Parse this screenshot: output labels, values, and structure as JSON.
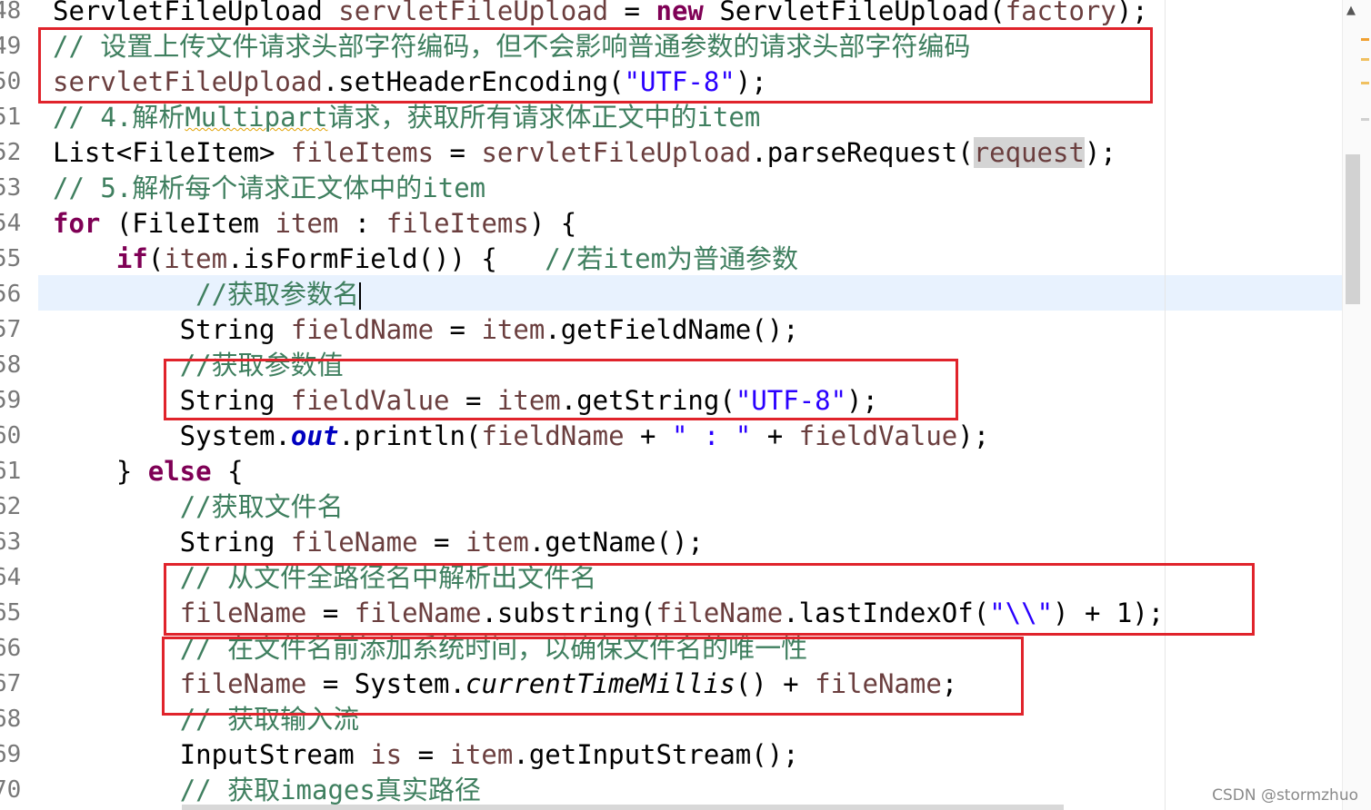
{
  "editor": {
    "lines": [
      {
        "n": "48",
        "tokens": [
          {
            "t": "ServletFileUpload "
          },
          {
            "t": "servletFileUpload",
            "c": "var"
          },
          {
            "t": " = "
          },
          {
            "t": "new",
            "c": "kw"
          },
          {
            "t": " ServletFileUpload("
          },
          {
            "t": "factory",
            "c": "var"
          },
          {
            "t": ");"
          }
        ]
      },
      {
        "n": "49",
        "tokens": [
          {
            "t": "// 设置上传文件请求头部字符编码，但不会影响普通参数的请求头部字符编码",
            "c": "cm"
          }
        ]
      },
      {
        "n": "50",
        "tokens": [
          {
            "t": "servletFileUpload",
            "c": "var"
          },
          {
            "t": ".setHeaderEncoding("
          },
          {
            "t": "\"UTF-8\"",
            "c": "str"
          },
          {
            "t": ");"
          }
        ]
      },
      {
        "n": "51",
        "tokens": [
          {
            "t": "// 4.解析",
            "c": "cm"
          },
          {
            "t": "Multipart",
            "c": "cm",
            "s": "sq"
          },
          {
            "t": "请求，获取所有请求体正文中的item",
            "c": "cm"
          }
        ]
      },
      {
        "n": "52",
        "tokens": [
          {
            "t": "List<FileItem> "
          },
          {
            "t": "fileItems",
            "c": "var"
          },
          {
            "t": " = "
          },
          {
            "t": "servletFileUpload",
            "c": "var"
          },
          {
            "t": ".parseRequest("
          },
          {
            "t": "request",
            "c": "var",
            "s": "hl"
          },
          {
            "t": ");"
          }
        ]
      },
      {
        "n": "53",
        "tokens": [
          {
            "t": "// 5.解析每个请求正文体中的item",
            "c": "cm"
          }
        ]
      },
      {
        "n": "54",
        "tokens": [
          {
            "t": "for",
            "c": "kw"
          },
          {
            "t": " (FileItem "
          },
          {
            "t": "item",
            "c": "var"
          },
          {
            "t": " : "
          },
          {
            "t": "fileItems",
            "c": "var"
          },
          {
            "t": ") {"
          }
        ]
      },
      {
        "n": "55",
        "tokens": [
          {
            "t": "    "
          },
          {
            "t": "if",
            "c": "kw"
          },
          {
            "t": "("
          },
          {
            "t": "item",
            "c": "var"
          },
          {
            "t": ".isFormField()) {   "
          },
          {
            "t": "//若item为普通参数",
            "c": "cm"
          }
        ]
      },
      {
        "n": "56",
        "tokens": [
          {
            "t": "         "
          },
          {
            "t": "//获取参数名",
            "c": "cm"
          },
          {
            "t": "",
            "caret": true
          }
        ]
      },
      {
        "n": "57",
        "tokens": [
          {
            "t": "        String "
          },
          {
            "t": "fieldName",
            "c": "var"
          },
          {
            "t": " = "
          },
          {
            "t": "item",
            "c": "var"
          },
          {
            "t": ".getFieldName();"
          }
        ]
      },
      {
        "n": "58",
        "tokens": [
          {
            "t": "        "
          },
          {
            "t": "//获取参数值",
            "c": "cm"
          }
        ]
      },
      {
        "n": "59",
        "tokens": [
          {
            "t": "        String "
          },
          {
            "t": "fieldValue",
            "c": "var"
          },
          {
            "t": " = "
          },
          {
            "t": "item",
            "c": "var"
          },
          {
            "t": ".getString("
          },
          {
            "t": "\"UTF-8\"",
            "c": "str"
          },
          {
            "t": ");"
          }
        ]
      },
      {
        "n": "60",
        "tokens": [
          {
            "t": "        System."
          },
          {
            "t": "out",
            "c": "sf"
          },
          {
            "t": ".println("
          },
          {
            "t": "fieldName",
            "c": "var"
          },
          {
            "t": " + "
          },
          {
            "t": "\" : \"",
            "c": "str"
          },
          {
            "t": " + "
          },
          {
            "t": "fieldValue",
            "c": "var"
          },
          {
            "t": ");"
          }
        ]
      },
      {
        "n": "61",
        "tokens": [
          {
            "t": "    } "
          },
          {
            "t": "else",
            "c": "kw"
          },
          {
            "t": " {"
          }
        ]
      },
      {
        "n": "62",
        "tokens": [
          {
            "t": "        "
          },
          {
            "t": "//获取文件名",
            "c": "cm"
          }
        ]
      },
      {
        "n": "63",
        "tokens": [
          {
            "t": "        String "
          },
          {
            "t": "fileName",
            "c": "var"
          },
          {
            "t": " = "
          },
          {
            "t": "item",
            "c": "var"
          },
          {
            "t": ".getName();"
          }
        ]
      },
      {
        "n": "64",
        "tokens": [
          {
            "t": "        "
          },
          {
            "t": "// 从文件全路径名中解析出文件名",
            "c": "cm"
          }
        ]
      },
      {
        "n": "65",
        "tokens": [
          {
            "t": "        "
          },
          {
            "t": "fileName",
            "c": "var"
          },
          {
            "t": " = "
          },
          {
            "t": "fileName",
            "c": "var"
          },
          {
            "t": ".substring("
          },
          {
            "t": "fileName",
            "c": "var"
          },
          {
            "t": ".lastIndexOf("
          },
          {
            "t": "\"\\\\\"",
            "c": "str"
          },
          {
            "t": ") + 1);"
          }
        ]
      },
      {
        "n": "66",
        "tokens": [
          {
            "t": "        "
          },
          {
            "t": "// 在文件名前添加系统时间，以确保文件名的唯一性",
            "c": "cm"
          }
        ]
      },
      {
        "n": "67",
        "tokens": [
          {
            "t": "        "
          },
          {
            "t": "fileName",
            "c": "var"
          },
          {
            "t": " = System."
          },
          {
            "t": "currentTimeMillis",
            "c": "sm"
          },
          {
            "t": "() + "
          },
          {
            "t": "fileName",
            "c": "var"
          },
          {
            "t": ";"
          }
        ]
      },
      {
        "n": "68",
        "tokens": [
          {
            "t": "        "
          },
          {
            "t": "// 获取输入流",
            "c": "cm"
          }
        ]
      },
      {
        "n": "69",
        "tokens": [
          {
            "t": "        InputStream "
          },
          {
            "t": "is",
            "c": "var"
          },
          {
            "t": " = "
          },
          {
            "t": "item",
            "c": "var"
          },
          {
            "t": ".getInputStream();"
          }
        ]
      },
      {
        "n": "70",
        "tokens": [
          {
            "t": "        "
          },
          {
            "t": "// 获取images真实路径",
            "c": "cm"
          }
        ]
      }
    ]
  },
  "scrollbar": {
    "arrow_icon": "▲",
    "marker_colors": [
      "#f0a030",
      "#f0c060",
      "#d0d0d0"
    ]
  },
  "annotation_color": "#e0232b",
  "watermark": "CSDN @stormzhuo"
}
